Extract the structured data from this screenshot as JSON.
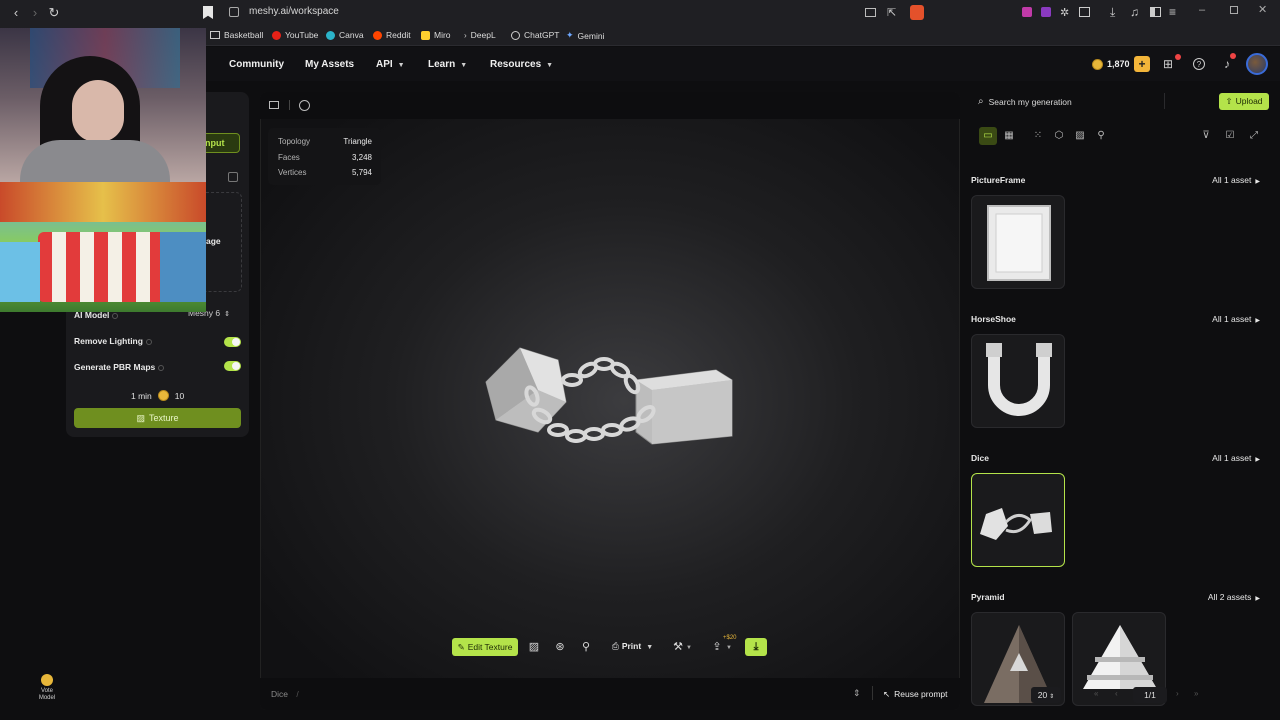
{
  "browser": {
    "url": "meshy.ai/workspace",
    "bookmarks": [
      "Basketball",
      "YouTube",
      "Canva",
      "Reddit",
      "Miro",
      "DeepL",
      "ChatGPT",
      "Gemini"
    ]
  },
  "header": {
    "nav": [
      {
        "label": "Community",
        "dropdown": false
      },
      {
        "label": "My Assets",
        "dropdown": false
      },
      {
        "label": "API",
        "dropdown": true
      },
      {
        "label": "Learn",
        "dropdown": true
      },
      {
        "label": "Resources",
        "dropdown": true
      }
    ],
    "credits": "1,870"
  },
  "left_panel": {
    "input_button": "nput",
    "image_label": "age",
    "ai_model_label": "AI Model",
    "ai_model_value": "Meshy 6",
    "remove_lighting_label": "Remove Lighting",
    "remove_lighting_on": true,
    "pbr_label": "Generate PBR Maps",
    "pbr_on": true,
    "time": "1 min",
    "cost": "10",
    "texture_button": "Texture",
    "vote_model": "Vote Model"
  },
  "viewer": {
    "stats": [
      {
        "key": "Topology",
        "value": "Triangle"
      },
      {
        "key": "Faces",
        "value": "3,248"
      },
      {
        "key": "Vertices",
        "value": "5,794"
      }
    ],
    "toolbar": {
      "edit_texture": "Edit Texture",
      "print": "Print",
      "badge": "+$20"
    },
    "breadcrumb": "Dice",
    "breadcrumb_sep": "/",
    "reuse_prompt": "Reuse prompt"
  },
  "right_panel": {
    "search_placeholder": "Search my generation",
    "upload": "Upload",
    "categories": [
      {
        "name": "PictureFrame",
        "all_label": "All 1 asset"
      },
      {
        "name": "HorseShoe",
        "all_label": "All 1 asset"
      },
      {
        "name": "Dice",
        "all_label": "All 1 asset"
      },
      {
        "name": "Pyramid",
        "all_label": "All 2 assets"
      }
    ],
    "page_size": "20",
    "page": "1/1"
  },
  "colors": {
    "accent": "#b4e34a",
    "credit": "#f3b53a",
    "background": "#0e0e10"
  }
}
